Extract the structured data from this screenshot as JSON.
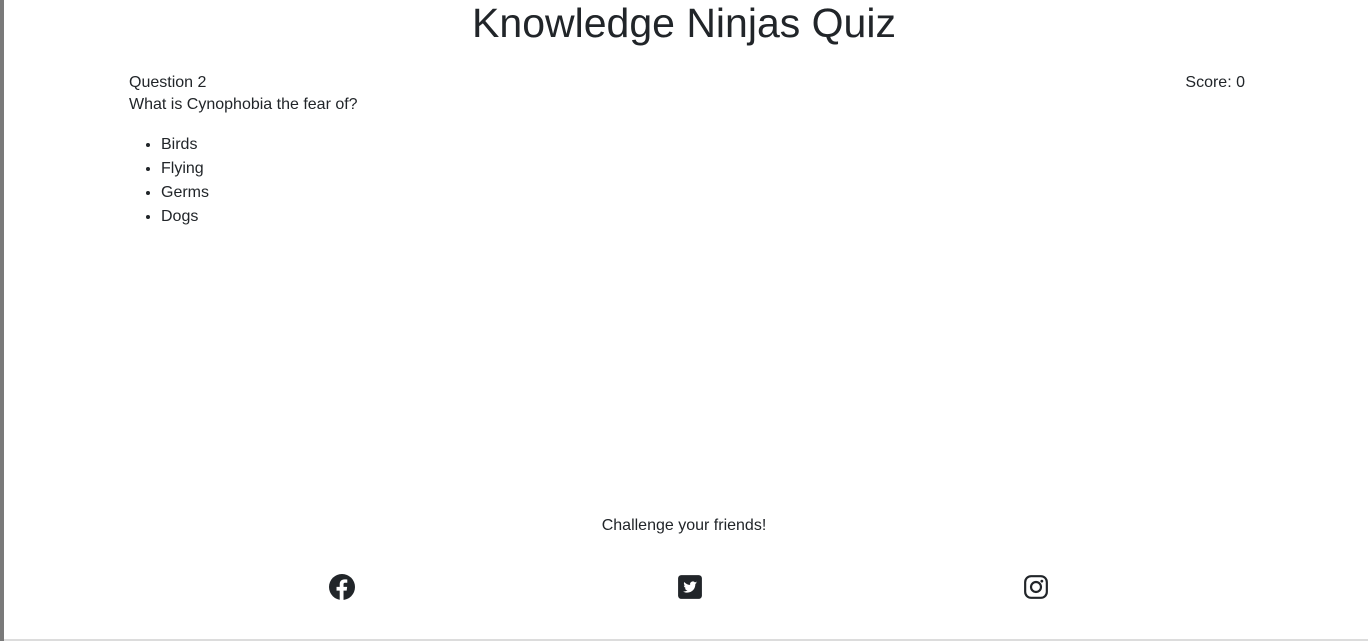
{
  "header": {
    "title": "Knowledge Ninjas Quiz"
  },
  "quiz": {
    "question_label": "Question 2",
    "score_label": "Score: 0",
    "question_text": "What is Cynophobia the fear of?",
    "answers": [
      "Birds",
      "Flying",
      "Germs",
      "Dogs"
    ]
  },
  "footer": {
    "challenge_text": "Challenge your friends!",
    "social_icons": [
      "facebook-icon",
      "twitter-icon",
      "instagram-icon"
    ]
  }
}
